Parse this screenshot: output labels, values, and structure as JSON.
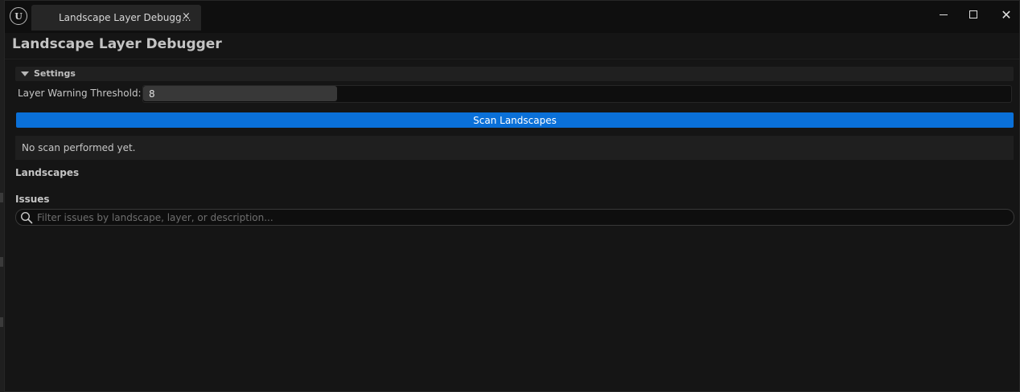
{
  "window": {
    "tab_title": "Landscape Layer Debugg…",
    "tab_close": "×",
    "close_glyph": "✕"
  },
  "page": {
    "title": "Landscape Layer Debugger"
  },
  "settings": {
    "header": "Settings",
    "threshold_label": "Layer Warning Threshold:",
    "threshold_value": "8"
  },
  "actions": {
    "scan_label": "Scan Landscapes"
  },
  "status": {
    "message": "No scan performed yet."
  },
  "sections": {
    "landscapes": "Landscapes",
    "issues": "Issues"
  },
  "search": {
    "placeholder": "Filter issues by landscape, layer, or description..."
  },
  "colors": {
    "accent": "#0a70d8",
    "background": "#151515",
    "titlebar": "#0f0f0f"
  },
  "icons": {
    "app": "unreal-logo-icon",
    "search": "search-icon",
    "collapse": "triangle-down-icon"
  }
}
